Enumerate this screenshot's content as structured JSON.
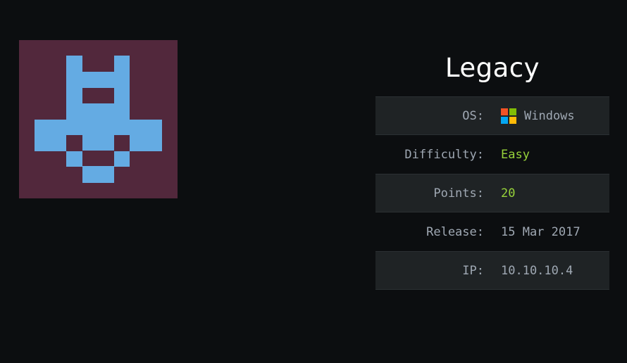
{
  "machine": {
    "name": "Legacy",
    "avatar_icon": "pixel-robot-icon",
    "avatar_colors": {
      "background": "#52283c",
      "foreground": "#64abe3"
    }
  },
  "details": [
    {
      "label": "OS:",
      "value": "Windows",
      "icon": "windows-logo-icon",
      "value_color": "#9fa8b3"
    },
    {
      "label": "Difficulty:",
      "value": "Easy",
      "value_color": "#97d33a"
    },
    {
      "label": "Points:",
      "value": "20",
      "value_color": "#97d33a"
    },
    {
      "label": "Release:",
      "value": "15 Mar 2017",
      "value_color": "#9fa8b3"
    },
    {
      "label": "IP:",
      "value": "10.10.10.4",
      "value_color": "#9fa8b3"
    }
  ],
  "colors": {
    "page_background": "#0c0e10",
    "row_shaded": "#1f2325",
    "label": "#9fa8b3",
    "accent_green": "#97d33a",
    "windows_logo": [
      "#f35325",
      "#81bc06",
      "#05a6f0",
      "#ffba08"
    ]
  }
}
